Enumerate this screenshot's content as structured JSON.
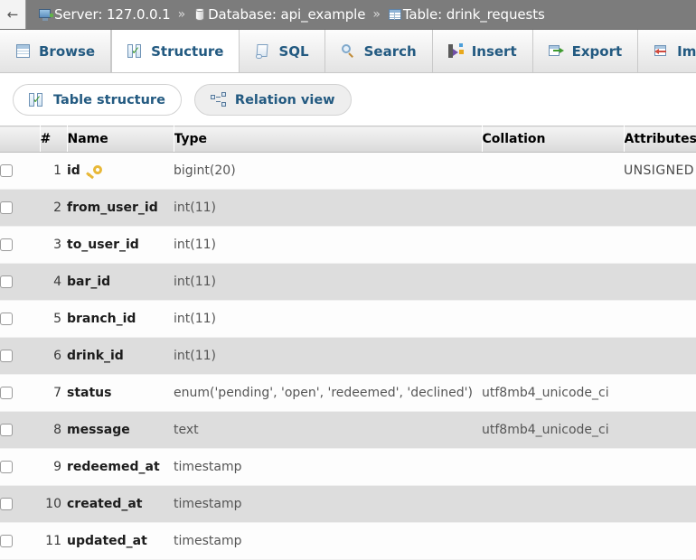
{
  "breadcrumb": {
    "back_label": "←",
    "items": [
      {
        "icon": "server-icon",
        "label": "Server: 127.0.0.1"
      },
      {
        "icon": "database-icon",
        "label": "Database: api_example"
      },
      {
        "icon": "table-icon",
        "label": "Table: drink_requests"
      }
    ],
    "separator": "»",
    "background": "#7c7c7c",
    "text_color": "#ffffff"
  },
  "tabs": [
    {
      "label": "Browse",
      "icon": "browse-icon",
      "active": false
    },
    {
      "label": "Structure",
      "icon": "structure-icon",
      "active": true
    },
    {
      "label": "SQL",
      "icon": "sql-icon",
      "active": false
    },
    {
      "label": "Search",
      "icon": "search-icon",
      "active": false
    },
    {
      "label": "Insert",
      "icon": "insert-icon",
      "active": false
    },
    {
      "label": "Export",
      "icon": "export-icon",
      "active": false
    },
    {
      "label": "Import",
      "icon": "import-icon",
      "active": false
    }
  ],
  "subtabs": [
    {
      "label": "Table structure",
      "icon": "structure-icon",
      "active": true
    },
    {
      "label": "Relation view",
      "icon": "relation-icon",
      "active": false
    }
  ],
  "structure": {
    "columns": [
      "",
      "#",
      "Name",
      "Type",
      "Collation",
      "Attributes"
    ],
    "rows": [
      {
        "num": "1",
        "name": "id",
        "primary_key": true,
        "type": "bigint(20)",
        "collation": "",
        "attributes": "UNSIGNED"
      },
      {
        "num": "2",
        "name": "from_user_id",
        "primary_key": false,
        "type": "int(11)",
        "collation": "",
        "attributes": ""
      },
      {
        "num": "3",
        "name": "to_user_id",
        "primary_key": false,
        "type": "int(11)",
        "collation": "",
        "attributes": ""
      },
      {
        "num": "4",
        "name": "bar_id",
        "primary_key": false,
        "type": "int(11)",
        "collation": "",
        "attributes": ""
      },
      {
        "num": "5",
        "name": "branch_id",
        "primary_key": false,
        "type": "int(11)",
        "collation": "",
        "attributes": ""
      },
      {
        "num": "6",
        "name": "drink_id",
        "primary_key": false,
        "type": "int(11)",
        "collation": "",
        "attributes": ""
      },
      {
        "num": "7",
        "name": "status",
        "primary_key": false,
        "type": "enum('pending', 'open', 'redeemed', 'declined')",
        "collation": "utf8mb4_unicode_ci",
        "attributes": ""
      },
      {
        "num": "8",
        "name": "message",
        "primary_key": false,
        "type": "text",
        "collation": "utf8mb4_unicode_ci",
        "attributes": ""
      },
      {
        "num": "9",
        "name": "redeemed_at",
        "primary_key": false,
        "type": "timestamp",
        "collation": "",
        "attributes": ""
      },
      {
        "num": "10",
        "name": "created_at",
        "primary_key": false,
        "type": "timestamp",
        "collation": "",
        "attributes": ""
      },
      {
        "num": "11",
        "name": "updated_at",
        "primary_key": false,
        "type": "timestamp",
        "collation": "",
        "attributes": ""
      }
    ]
  }
}
